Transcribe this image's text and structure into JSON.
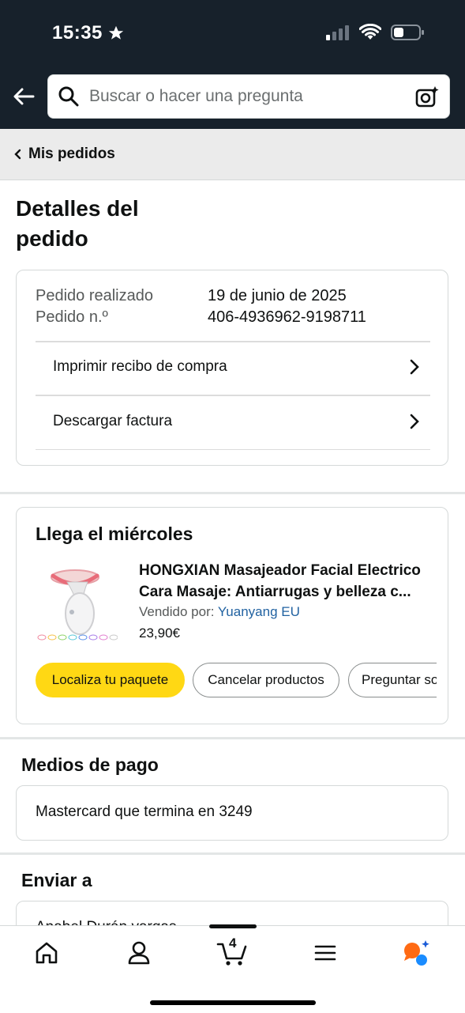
{
  "status_bar": {
    "time": "15:35"
  },
  "search": {
    "placeholder": "Buscar o hacer una pregunta"
  },
  "breadcrumb": {
    "label": "Mis pedidos"
  },
  "page": {
    "title": "Detalles del pedido"
  },
  "order": {
    "placed_label": "Pedido realizado",
    "placed_value": "19 de junio de 2025",
    "number_label": "Pedido n.º",
    "number_value": "406-4936962-9198711",
    "links": [
      {
        "label": "Imprimir recibo de compra"
      },
      {
        "label": "Descargar factura"
      }
    ]
  },
  "shipment": {
    "title": "Llega el miércoles",
    "product": {
      "name_line1": "HONGXIAN Masajeador Facial Electrico",
      "name_line2": "Cara Masaje: Antiarrugas y belleza c...",
      "sold_by_label": "Vendido por:",
      "seller": "Yuanyang EU",
      "price": "23,90€"
    },
    "buttons": {
      "track": "Localiza tu paquete",
      "cancel": "Cancelar productos",
      "ask": "Preguntar sobre el producto"
    }
  },
  "payment": {
    "title": "Medios de pago",
    "method": "Mastercard  que termina en 3249"
  },
  "shipping": {
    "title": "Enviar a",
    "name": "Anabel Durán vargas"
  },
  "bottom_nav": {
    "cart_count": "4"
  },
  "colors": {
    "header_bg": "#17212b",
    "primary_button": "#ffd814",
    "link": "#2162a1"
  }
}
